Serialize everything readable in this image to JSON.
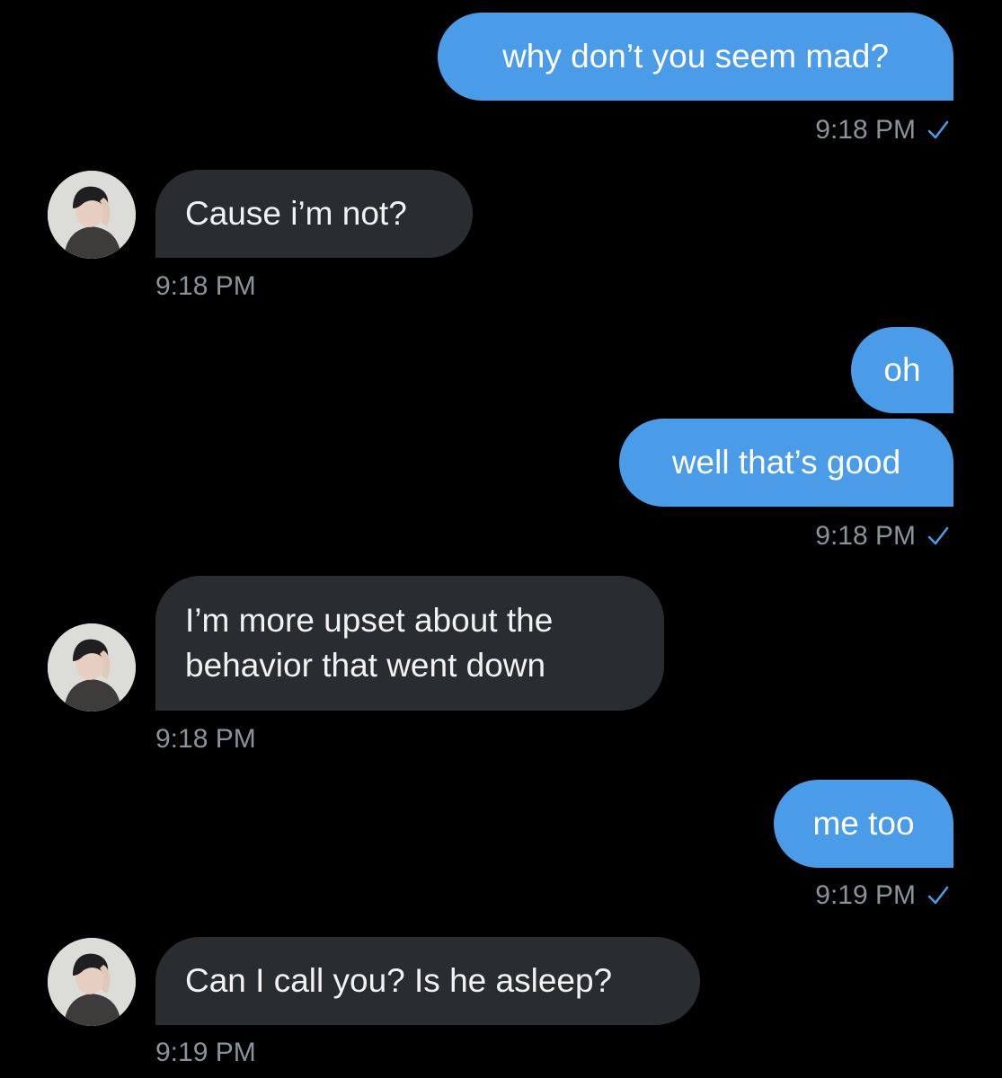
{
  "conversation": {
    "colors": {
      "background": "#000000",
      "sent_bubble": "#4a9be8",
      "received_bubble": "#2a2d30",
      "timestamp": "#8b9299",
      "read_check": "#4a9be8"
    },
    "messages": [
      {
        "direction": "sent",
        "text": "why don’t you seem mad?"
      },
      {
        "direction": "received",
        "text": "Cause i’m not?"
      },
      {
        "direction": "sent",
        "text": "oh"
      },
      {
        "direction": "sent",
        "text": "well that’s good"
      },
      {
        "direction": "received",
        "lines": [
          "I’m more upset about the",
          "behavior that went down"
        ]
      },
      {
        "direction": "sent",
        "text": "me too"
      },
      {
        "direction": "received",
        "text": "Can I call you? Is he asleep?"
      }
    ],
    "timestamps": [
      "9:18 PM",
      "9:18 PM",
      "9:18 PM",
      "9:18 PM",
      "9:19 PM",
      "9:19 PM"
    ],
    "read_icon": "checkmark-icon",
    "avatar_icon": "contact-avatar-photo"
  }
}
